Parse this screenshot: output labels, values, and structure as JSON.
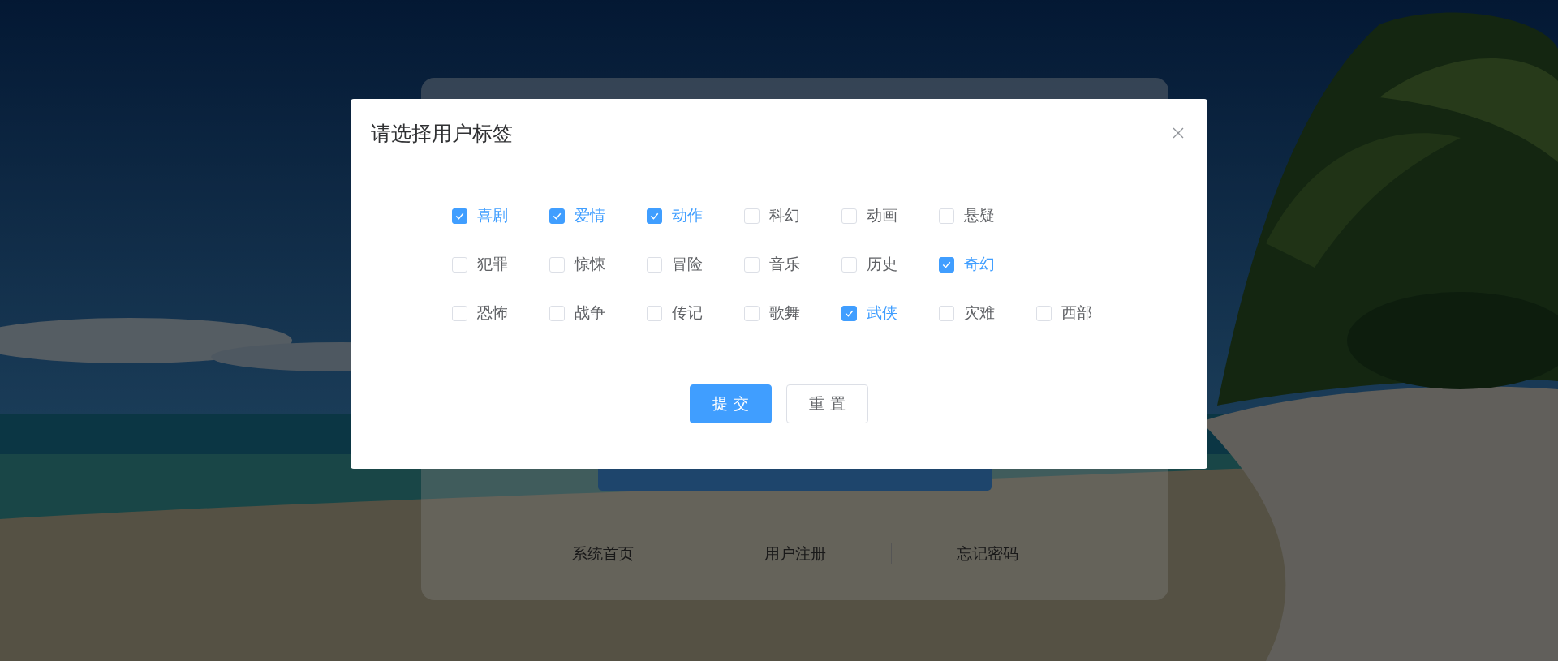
{
  "login_card": {
    "links": [
      "系统首页",
      "用户注册",
      "忘记密码"
    ]
  },
  "dialog": {
    "title": "请选择用户标签",
    "tag_rows": [
      [
        {
          "label": "喜剧",
          "checked": true
        },
        {
          "label": "爱情",
          "checked": true
        },
        {
          "label": "动作",
          "checked": true
        },
        {
          "label": "科幻",
          "checked": false
        },
        {
          "label": "动画",
          "checked": false
        },
        {
          "label": "悬疑",
          "checked": false
        }
      ],
      [
        {
          "label": "犯罪",
          "checked": false
        },
        {
          "label": "惊悚",
          "checked": false
        },
        {
          "label": "冒险",
          "checked": false
        },
        {
          "label": "音乐",
          "checked": false
        },
        {
          "label": "历史",
          "checked": false
        },
        {
          "label": "奇幻",
          "checked": true
        }
      ],
      [
        {
          "label": "恐怖",
          "checked": false
        },
        {
          "label": "战争",
          "checked": false
        },
        {
          "label": "传记",
          "checked": false
        },
        {
          "label": "歌舞",
          "checked": false
        },
        {
          "label": "武侠",
          "checked": true
        },
        {
          "label": "灾难",
          "checked": false
        },
        {
          "label": "西部",
          "checked": false
        }
      ]
    ],
    "buttons": [
      {
        "label": "提 交",
        "kind": "primary"
      },
      {
        "label": "重 置",
        "kind": "plain"
      }
    ]
  }
}
